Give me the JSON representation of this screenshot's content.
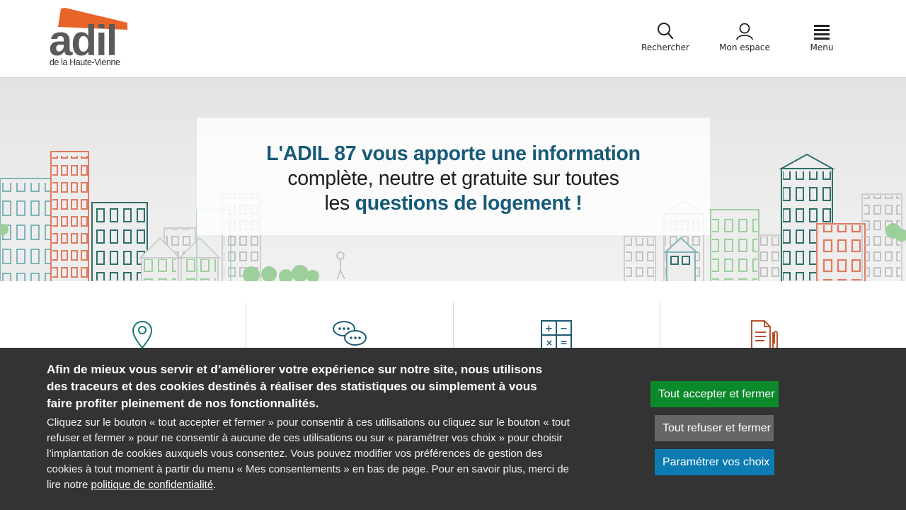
{
  "header": {
    "logo_text": "adil",
    "logo_sub": "de la Haute-Vienne",
    "search_label": "Rechercher",
    "account_label": "Mon espace",
    "menu_label": "Menu"
  },
  "hero": {
    "line1_highlight": "L'ADIL 87 vous apporte une information",
    "line2": "complète, neutre et gratuite sur toutes",
    "line3_prefix": "les ",
    "line3_highlight": "questions de logement !"
  },
  "features": [
    {
      "icon": "map-pin-icon"
    },
    {
      "icon": "chat-bubbles-icon"
    },
    {
      "icon": "calculator-icon"
    },
    {
      "icon": "document-clip-icon"
    }
  ],
  "cookie": {
    "title": "Afin de mieux vous servir et d’améliorer votre expérience sur notre site, nous utilisons des traceurs et des cookies destinés à réaliser des statistiques ou simplement à vous faire profiter pleinement de nos fonctionnalités.",
    "body": "Cliquez sur le bouton « tout accepter et fermer » pour consentir à ces utilisations ou cliquez sur le bouton « tout refuser et fermer » pour ne consentir à aucune de ces utilisations ou sur « paramétrer vos choix » pour choisir l’implantation de cookies auxquels vous consentez. Vous pouvez modifier vos préférences de gestion des cookies à tout moment à partir du menu « Mes consentements » en bas de page. Pour en savoir plus, merci de lire notre ",
    "link": "politique de confidentialité",
    "body_end": ".",
    "accept": "Tout accepter et fermer",
    "refuse": "Tout refuser et fermer",
    "params": "Paramétrer vos choix"
  },
  "colors": {
    "brand_orange": "#e9642b",
    "brand_teal": "#175a78",
    "accept_green": "#0b8a2b",
    "refuse_grey": "#666666",
    "params_blue": "#0b7bb2",
    "banner_bg": "#333333"
  }
}
